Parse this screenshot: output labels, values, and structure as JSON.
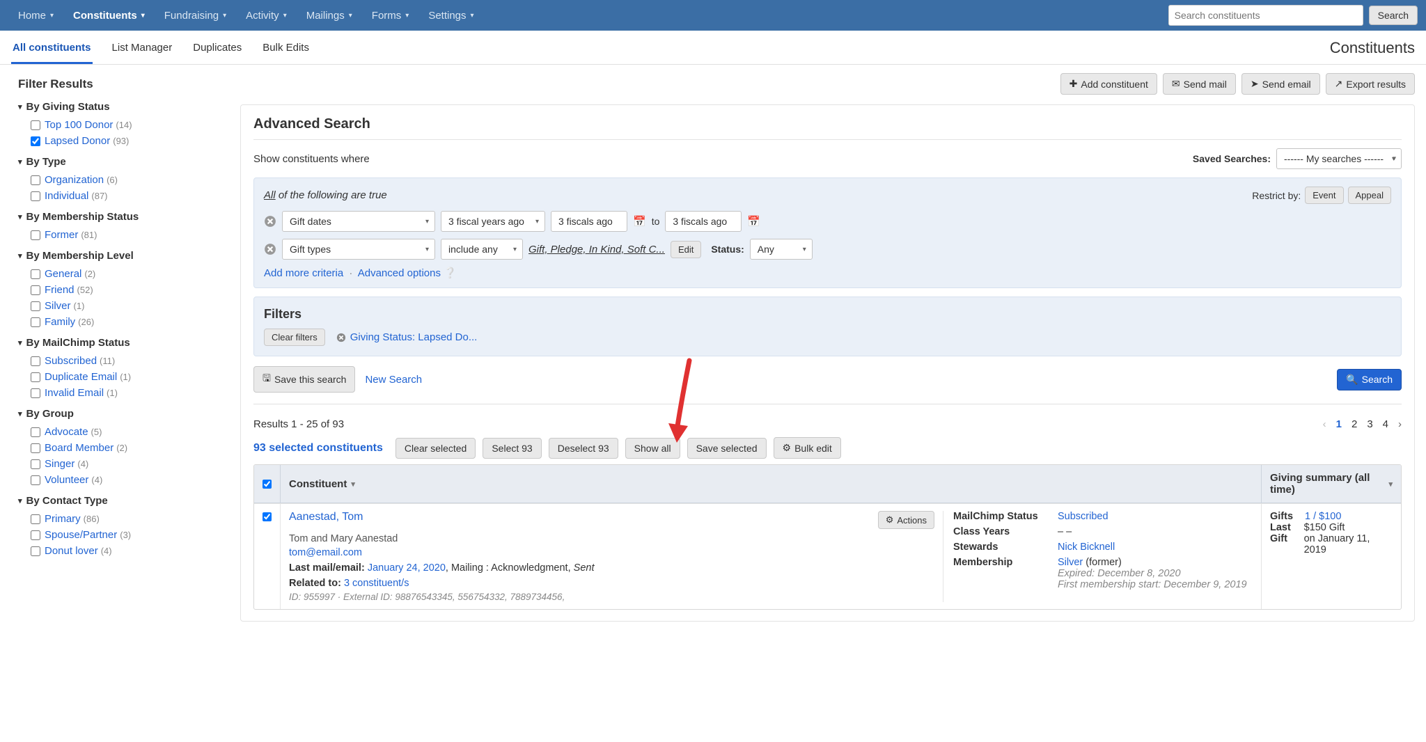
{
  "topnav": {
    "items": [
      "Home",
      "Constituents",
      "Fundraising",
      "Activity",
      "Mailings",
      "Forms",
      "Settings"
    ],
    "active": 1,
    "search_placeholder": "Search constituents",
    "search_button": "Search"
  },
  "subnav": {
    "tabs": [
      "All constituents",
      "List Manager",
      "Duplicates",
      "Bulk Edits"
    ],
    "active": 0,
    "page_title": "Constituents"
  },
  "actions": {
    "add": "Add constituent",
    "send_mail": "Send mail",
    "send_email": "Send email",
    "export": "Export results"
  },
  "sidebar": {
    "title": "Filter Results",
    "groups": [
      {
        "title": "By Giving Status",
        "items": [
          {
            "label": "Top 100 Donor",
            "count": "(14)",
            "checked": false
          },
          {
            "label": "Lapsed Donor",
            "count": "(93)",
            "checked": true
          }
        ]
      },
      {
        "title": "By Type",
        "items": [
          {
            "label": "Organization",
            "count": "(6)",
            "checked": false
          },
          {
            "label": "Individual",
            "count": "(87)",
            "checked": false
          }
        ]
      },
      {
        "title": "By Membership Status",
        "items": [
          {
            "label": "Former",
            "count": "(81)",
            "checked": false
          }
        ]
      },
      {
        "title": "By Membership Level",
        "items": [
          {
            "label": "General",
            "count": "(2)",
            "checked": false
          },
          {
            "label": "Friend",
            "count": "(52)",
            "checked": false
          },
          {
            "label": "Silver",
            "count": "(1)",
            "checked": false
          },
          {
            "label": "Family",
            "count": "(26)",
            "checked": false
          }
        ]
      },
      {
        "title": "By MailChimp Status",
        "items": [
          {
            "label": "Subscribed",
            "count": "(11)",
            "checked": false
          },
          {
            "label": "Duplicate Email",
            "count": "(1)",
            "checked": false
          },
          {
            "label": "Invalid Email",
            "count": "(1)",
            "checked": false
          }
        ]
      },
      {
        "title": "By Group",
        "items": [
          {
            "label": "Advocate",
            "count": "(5)",
            "checked": false
          },
          {
            "label": "Board Member",
            "count": "(2)",
            "checked": false
          },
          {
            "label": "Singer",
            "count": "(4)",
            "checked": false
          },
          {
            "label": "Volunteer",
            "count": "(4)",
            "checked": false
          }
        ]
      },
      {
        "title": "By Contact Type",
        "items": [
          {
            "label": "Primary",
            "count": "(86)",
            "checked": false
          },
          {
            "label": "Spouse/Partner",
            "count": "(3)",
            "checked": false
          },
          {
            "label": "Donut lover",
            "count": "(4)",
            "checked": false
          }
        ]
      }
    ]
  },
  "advanced": {
    "heading": "Advanced Search",
    "show_where": "Show constituents where",
    "saved_label": "Saved Searches:",
    "saved_value": "------ My searches ------",
    "all_true_prefix": "All",
    "all_true_rest": " of the following are true",
    "restrict_label": "Restrict by:",
    "restrict_event": "Event",
    "restrict_appeal": "Appeal",
    "crit1": {
      "field": "Gift dates",
      "range": "3 fiscal years ago",
      "from": "3 fiscals ago",
      "to_label": "to",
      "to": "3 fiscals ago"
    },
    "crit2": {
      "field": "Gift types",
      "mode": "include any",
      "types": "Gift, Pledge, In Kind, Soft C...",
      "edit": "Edit",
      "status_label": "Status:",
      "status": "Any"
    },
    "add_more": "Add more criteria",
    "adv_opt": "Advanced options"
  },
  "filters": {
    "heading": "Filters",
    "clear": "Clear filters",
    "chip": "Giving Status: Lapsed Do..."
  },
  "saverow": {
    "save": "Save this search",
    "new": "New Search",
    "search": "Search"
  },
  "results": {
    "summary": "Results 1 - 25 of 93",
    "pages": [
      "1",
      "2",
      "3",
      "4"
    ],
    "selected_label": "93 selected constituents",
    "btns": {
      "clear": "Clear selected",
      "select": "Select 93",
      "deselect": "Deselect 93",
      "showall": "Show all",
      "save": "Save selected",
      "bulk": "Bulk edit"
    }
  },
  "table": {
    "col_constituent": "Constituent",
    "col_giving": "Giving summary (all time)",
    "row": {
      "name": "Aanestad, Tom",
      "actions": "Actions",
      "full": "Tom and Mary Aanestad",
      "email": "tom@email.com",
      "last_mail_label": "Last mail/email:",
      "last_mail_date": "January 24, 2020",
      "last_mail_rest": ", Mailing : Acknowledgment, ",
      "last_mail_status": "Sent",
      "related_label": "Related to:",
      "related_link": "3 constituent/s",
      "idline": "ID: 955997 · External ID: 98876543345, 556754332, 7889734456,",
      "mc_label": "MailChimp Status",
      "mc_val": "Subscribed",
      "cy_label": "Class Years",
      "cy_val": "– –",
      "st_label": "Stewards",
      "st_val": "Nick Bicknell",
      "mem_label": "Membership",
      "mem_link": "Silver",
      "mem_former": " (former)",
      "mem_exp": "Expired: December 8, 2020",
      "mem_first": "First membership start: December 9, 2019",
      "gifts_label": "Gifts",
      "gifts_val": "1 / $100",
      "last_label": "Last Gift",
      "last_val1": "$150 Gift",
      "last_val2": "on January 11, 2019"
    }
  }
}
